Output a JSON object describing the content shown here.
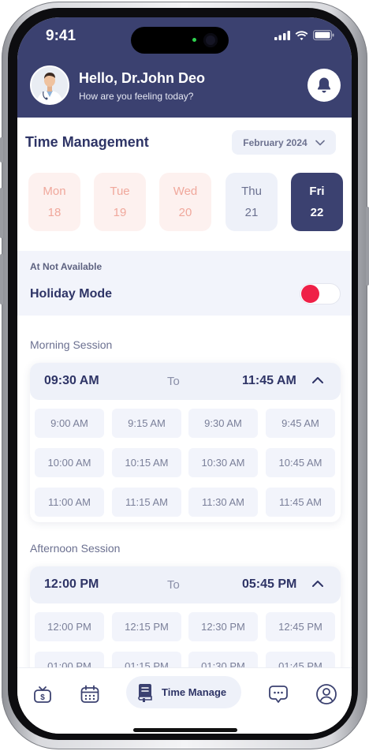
{
  "status_bar": {
    "time": "9:41"
  },
  "header": {
    "greeting": "Hello, Dr.John Deo",
    "subtitle": "How are you feeling today?"
  },
  "time_management": {
    "title": "Time Management",
    "month": "February 2024"
  },
  "days": [
    {
      "day": "Mon",
      "date": "18",
      "state": "past"
    },
    {
      "day": "Tue",
      "date": "19",
      "state": "past"
    },
    {
      "day": "Wed",
      "date": "20",
      "state": "past"
    },
    {
      "day": "Thu",
      "date": "21",
      "state": "upcoming"
    },
    {
      "day": "Fri",
      "date": "22",
      "state": "selected"
    }
  ],
  "holiday": {
    "caption": "At Not Available",
    "label": "Holiday Mode",
    "enabled": false
  },
  "morning": {
    "label": "Morning Session",
    "from": "09:30  AM",
    "to": "To",
    "end": "11:45  AM",
    "slots": [
      "9:00 AM",
      "9:15 AM",
      "9:30 AM",
      "9:45 AM",
      "10:00 AM",
      "10:15 AM",
      "10:30 AM",
      "10:45 AM",
      "11:00 AM",
      "11:15 AM",
      "11:30 AM",
      "11:45 AM"
    ]
  },
  "afternoon": {
    "label": "Afternoon Session",
    "from": "12:00  PM",
    "to": "To",
    "end": "05:45  PM",
    "slots": [
      "12:00 PM",
      "12:15 PM",
      "12:30 PM",
      "12:45 PM",
      "01:00 PM",
      "01:15 PM",
      "01:30 PM",
      "01:45 PM"
    ]
  },
  "bottom_nav": {
    "active_label": "Time Manage",
    "icons": [
      "wallet-icon",
      "calendar-icon",
      "schedule-icon",
      "chat-icon",
      "profile-icon"
    ]
  },
  "colors": {
    "header": "#3b4170",
    "accent": "#2e3466",
    "past_day_bg": "#fdf1ef",
    "past_day_text": "#f0a89c",
    "toggle_knob": "#ef2047"
  }
}
